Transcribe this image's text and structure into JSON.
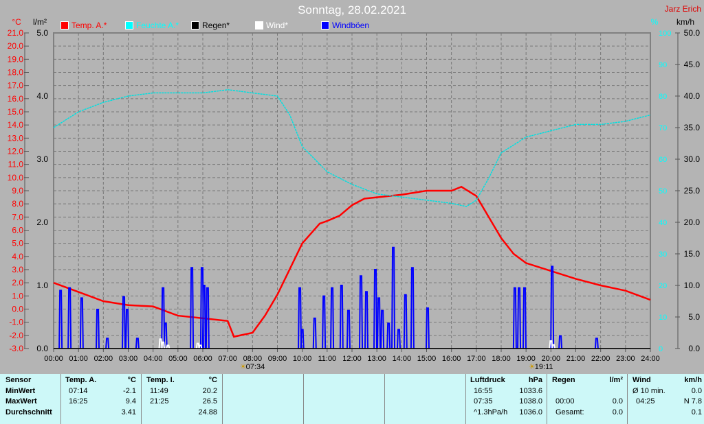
{
  "title": "Sonntag, 28.02.2021",
  "author": "Jarz Erich",
  "legend": [
    {
      "label": "Temp. A.*",
      "color": "#ff0000"
    },
    {
      "label": "Feuchte A.*",
      "color": "#00ffff"
    },
    {
      "label": "Regen*",
      "color": "#000000"
    },
    {
      "label": "Wind*",
      "color": "#ffffff"
    },
    {
      "label": "Windböen",
      "color": "#0000ff"
    }
  ],
  "sun": {
    "rise": "07:34",
    "set": "19:11"
  },
  "chart_data": {
    "type": "line",
    "x_ticks": [
      "00:00",
      "01:00",
      "02:00",
      "03:00",
      "04:00",
      "05:00",
      "06:00",
      "07:00",
      "08:00",
      "09:00",
      "10:00",
      "11:00",
      "12:00",
      "13:00",
      "14:00",
      "15:00",
      "16:00",
      "17:00",
      "18:00",
      "19:00",
      "20:00",
      "21:00",
      "22:00",
      "23:00",
      "24:00"
    ],
    "axes": {
      "temp": {
        "unit": "°C",
        "ylim": [
          -3,
          21
        ],
        "ticks": [
          "-3.0",
          "-2.0",
          "-1.0",
          "0.0",
          "1.0",
          "2.0",
          "3.0",
          "4.0",
          "5.0",
          "6.0",
          "7.0",
          "8.0",
          "9.0",
          "10.0",
          "11.0",
          "12.0",
          "13.0",
          "14.0",
          "15.0",
          "16.0",
          "17.0",
          "18.0",
          "19.0",
          "20.0",
          "21.0"
        ]
      },
      "rain": {
        "unit": "l/m²",
        "ylim": [
          0,
          5
        ],
        "ticks": [
          "0.0",
          "1.0",
          "2.0",
          "3.0",
          "4.0",
          "5.0"
        ]
      },
      "humidity": {
        "unit": "%",
        "ylim": [
          0,
          100
        ],
        "ticks": [
          "0",
          "10",
          "20",
          "30",
          "40",
          "50",
          "60",
          "70",
          "80",
          "90",
          "100"
        ]
      },
      "wind": {
        "unit": "km/h",
        "ylim": [
          0,
          50
        ],
        "ticks": [
          "0.0",
          "5.0",
          "10.0",
          "15.0",
          "20.0",
          "25.0",
          "30.0",
          "35.0",
          "40.0",
          "45.0",
          "50.0"
        ]
      }
    },
    "series": [
      {
        "name": "Temp. A.*",
        "axis": "temp",
        "x": [
          0,
          1,
          2,
          3,
          4,
          5,
          6,
          7,
          7.25,
          8,
          8.5,
          9,
          10,
          10.7,
          11,
          11.5,
          12,
          12.5,
          13,
          14,
          15,
          16,
          16.4,
          17,
          17.5,
          18,
          18.5,
          19,
          20,
          21,
          22,
          23,
          24
        ],
        "y": [
          2.0,
          1.3,
          0.6,
          0.3,
          0.2,
          -0.5,
          -0.7,
          -0.9,
          -2.1,
          -1.8,
          -0.5,
          1.1,
          5.0,
          6.5,
          6.7,
          7.1,
          7.9,
          8.4,
          8.5,
          8.7,
          9.0,
          9.0,
          9.3,
          8.6,
          7.0,
          5.4,
          4.2,
          3.5,
          2.9,
          2.3,
          1.8,
          1.4,
          0.7
        ]
      },
      {
        "name": "Feuchte A.*",
        "axis": "humidity",
        "x": [
          0,
          1,
          2,
          3,
          4,
          5,
          6,
          7,
          8,
          9,
          9.5,
          10,
          11,
          12,
          13,
          14,
          15,
          16,
          16.6,
          17,
          17.5,
          18,
          19,
          20,
          21,
          22,
          23,
          24
        ],
        "y": [
          70,
          75,
          78,
          80,
          81,
          81,
          81,
          82,
          81,
          80,
          74,
          64,
          56,
          52,
          49,
          48,
          47,
          46,
          45,
          47,
          54,
          62,
          67,
          69,
          71,
          71,
          72,
          74
        ]
      },
      {
        "name": "Windböen",
        "axis": "wind",
        "x": [
          0.28,
          0.64,
          1.13,
          1.77,
          2.16,
          2.82,
          2.96,
          3.37,
          4.4,
          4.5,
          5.56,
          5.97,
          6.05,
          6.19,
          9.9,
          10.0,
          10.5,
          10.87,
          11.2,
          11.58,
          11.86,
          12.36,
          12.58,
          12.94,
          13.08,
          13.22,
          13.47,
          13.66,
          13.88,
          14.15,
          14.43,
          15.04,
          18.55,
          18.72,
          18.94,
          20.05,
          20.38,
          21.84
        ],
        "y": [
          9.2,
          9.6,
          8,
          6.2,
          1.6,
          8.2,
          6.2,
          1.6,
          9.6,
          4,
          12.8,
          12.8,
          10,
          9.6,
          9.6,
          3,
          4.8,
          8.3,
          9.6,
          10,
          6,
          11.5,
          9,
          12.5,
          8,
          6,
          4,
          16,
          3,
          8.5,
          12.8,
          6.4,
          9.6,
          9.6,
          9.6,
          13,
          2,
          1.6
        ]
      },
      {
        "name": "Wind*",
        "axis": "wind",
        "x": [
          4.3,
          4.4,
          4.6,
          5.8,
          5.9,
          20.0,
          20.1
        ],
        "y": [
          1.5,
          1.0,
          0.5,
          0.8,
          0.5,
          1.2,
          0.6
        ]
      },
      {
        "name": "Regen*",
        "axis": "rain",
        "x": [
          0,
          24
        ],
        "y": [
          0,
          0
        ]
      }
    ]
  },
  "table": {
    "sensor": {
      "h": "Sensor",
      "r": [
        "MinWert",
        "MaxWert",
        "Durchschnitt"
      ]
    },
    "tempA": {
      "h": "Temp. A.",
      "u": "°C",
      "t": [
        "07:14",
        "16:25",
        ""
      ],
      "v": [
        "-2.1",
        "9.4",
        "3.41"
      ]
    },
    "tempI": {
      "h": "Temp. I.",
      "u": "°C",
      "t": [
        "11:49",
        "21:25",
        ""
      ],
      "v": [
        "20.2",
        "26.5",
        "24.88"
      ]
    },
    "press": {
      "h": "Luftdruck",
      "u": "hPa",
      "t": [
        "16:55",
        "07:35",
        "^1.3hPa/h"
      ],
      "v": [
        "1033.6",
        "1038.0",
        "1036.0"
      ]
    },
    "rain": {
      "h": "Regen",
      "u": "l/m²",
      "t": [
        "",
        "00:00",
        "Gesamt:"
      ],
      "v": [
        "",
        "0.0",
        "0.0"
      ]
    },
    "wind": {
      "h": "Wind",
      "u": "km/h",
      "t": [
        "Ø 10 min.",
        "04:25",
        ""
      ],
      "v": [
        "0.0",
        "N 7.8",
        "0.1"
      ]
    }
  }
}
